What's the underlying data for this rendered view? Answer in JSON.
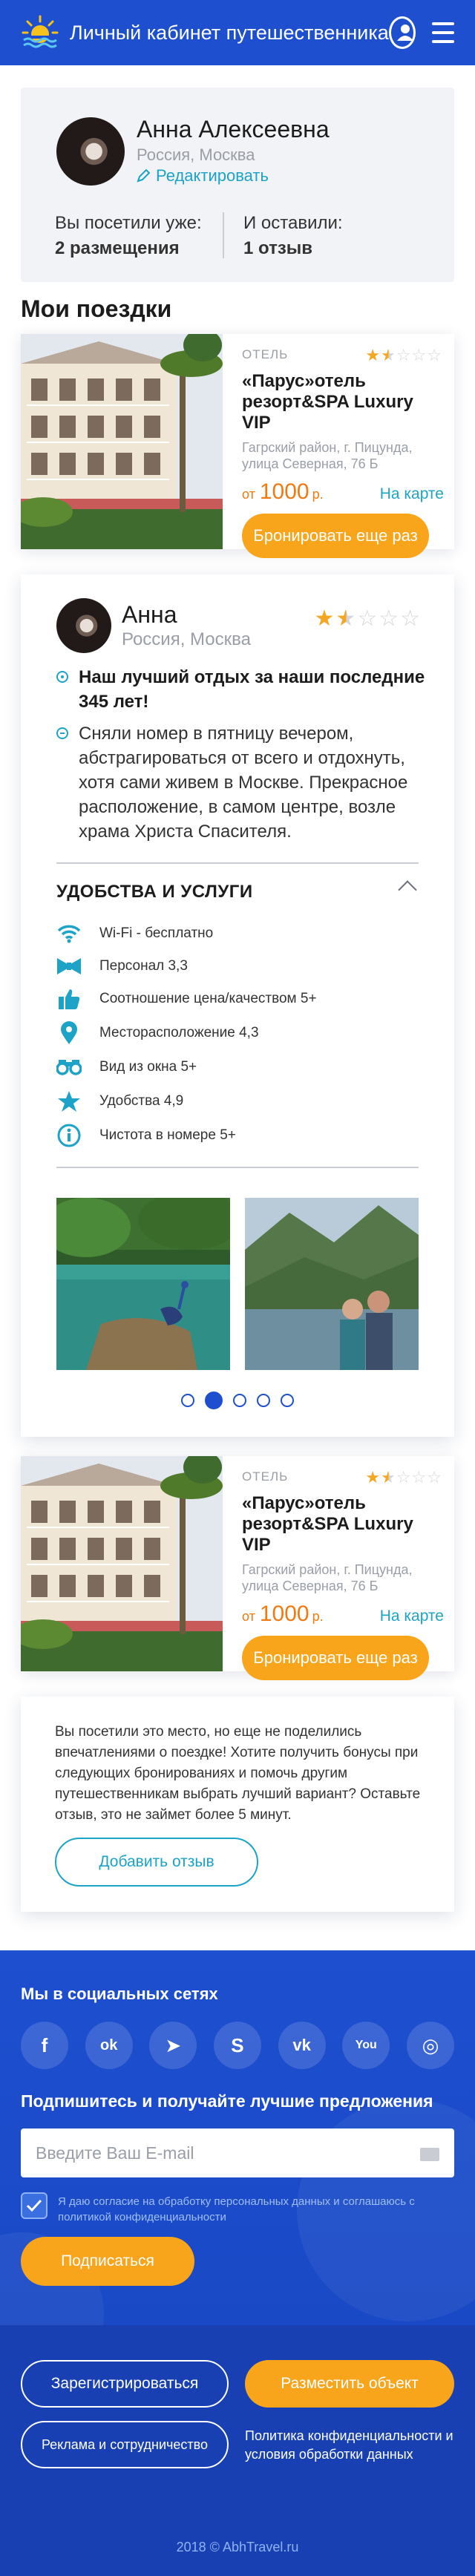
{
  "header": {
    "title": "Личный кабинет путешественника",
    "logo_icon": "sun-logo-icon",
    "user_icon": "user-icon",
    "menu_icon": "hamburger-menu-icon"
  },
  "profile": {
    "name": "Анна Алексеевна",
    "location": "Россия, Москва",
    "edit_label": "Редактировать",
    "visited_prefix": "Вы посетили уже:",
    "visited_value": "2 размещения",
    "left_prefix": "И оставили:",
    "left_value": "1 отзыв"
  },
  "trips": {
    "title": "Мои поездки",
    "items": [
      {
        "type": "ОТЕЛЬ",
        "rating": 1.5,
        "rating_max": 5,
        "name": "«Парус»отель резорт&SPA Luxury VIP",
        "address": "Гагрский район, г. Пицунда, улица Северная, 76 Б",
        "price_from": "от",
        "price": "1000",
        "currency": "р.",
        "map_label": "На карте",
        "book_label": "Бронировать еще раз"
      },
      {
        "type": "ОТЕЛЬ",
        "rating": 1.5,
        "rating_max": 5,
        "name": "«Парус»отель резорт&SPA Luxury VIP",
        "address": "Гагрский район, г. Пицунда, улица Северная, 76 Б",
        "price_from": "от",
        "price": "1000",
        "currency": "р.",
        "map_label": "На карте",
        "book_label": "Бронировать еще раз"
      }
    ]
  },
  "review": {
    "author": "Анна",
    "location": "Россия, Москва",
    "rating": 1.5,
    "rating_max": 5,
    "plus": "Наш лучший отдых за наши последние 345 лет!",
    "minus": "Сняли номер в пятницу вечером, абстрагироваться от всего и отдохнуть, хотя сами живем в Москве. Прекрасное расположение, в самом центре, возле храма Христа Спасителя.",
    "amenities_title": "УДОБСТВА И УСЛУГИ",
    "amenities": [
      {
        "icon": "wifi-icon",
        "label": "Wi-Fi - бесплатно"
      },
      {
        "icon": "bowtie-icon",
        "label": "Персонал 3,3"
      },
      {
        "icon": "thumbs-up-icon",
        "label": "Соотношение цена/качеством 5+"
      },
      {
        "icon": "map-pin-icon",
        "label": "Месторасположение 4,3"
      },
      {
        "icon": "binoculars-icon",
        "label": "Вид из окна 5+"
      },
      {
        "icon": "star-icon",
        "label": "Удобства 4,9"
      },
      {
        "icon": "info-icon",
        "label": "Чистота в номере 5+"
      }
    ],
    "slider_pages": 5,
    "slider_active": 2
  },
  "invite": {
    "text": "Вы посетили это место, но еще не поделились впечатлениями о поездке! Хотите получить бонусы при следующих бронированиях и помочь другим путешественникам выбрать лучший вариант? Оставьте отзыв, это не займет более 5 минут.",
    "button": "Добавить отзыв"
  },
  "footer": {
    "social_title": "Мы в социальных сетях",
    "socials": [
      {
        "icon": "facebook-icon",
        "glyph": "f"
      },
      {
        "icon": "odnoklassniki-icon",
        "glyph": "ok"
      },
      {
        "icon": "telegram-icon",
        "glyph": "➤"
      },
      {
        "icon": "skype-icon",
        "glyph": "S"
      },
      {
        "icon": "vk-icon",
        "glyph": "vk"
      },
      {
        "icon": "youtube-icon",
        "glyph": "You"
      },
      {
        "icon": "instagram-icon",
        "glyph": "◎"
      }
    ],
    "subscribe_title": "Подпишитесь и получайте лучшие предложения",
    "email_placeholder": "Введите Ваш E-mail",
    "consent": "Я даю согласие на обработку персональных данных и соглашаюсь с политикой конфиденциальности",
    "consent_checked": true,
    "subscribe_button": "Подписаться",
    "register_button": "Зарегистрироваться",
    "place_button": "Разместить объект",
    "ads_button": "Реклама и сотрудничество",
    "policy_link": "Политика конфиденциальности и условия обработки данных",
    "copyright": "2018 © AbhTravel.ru"
  },
  "colors": {
    "brand_blue": "#1d4fcf",
    "accent_orange": "#f8a51c",
    "link_cyan": "#1da3c7",
    "star": "#f5a623"
  }
}
